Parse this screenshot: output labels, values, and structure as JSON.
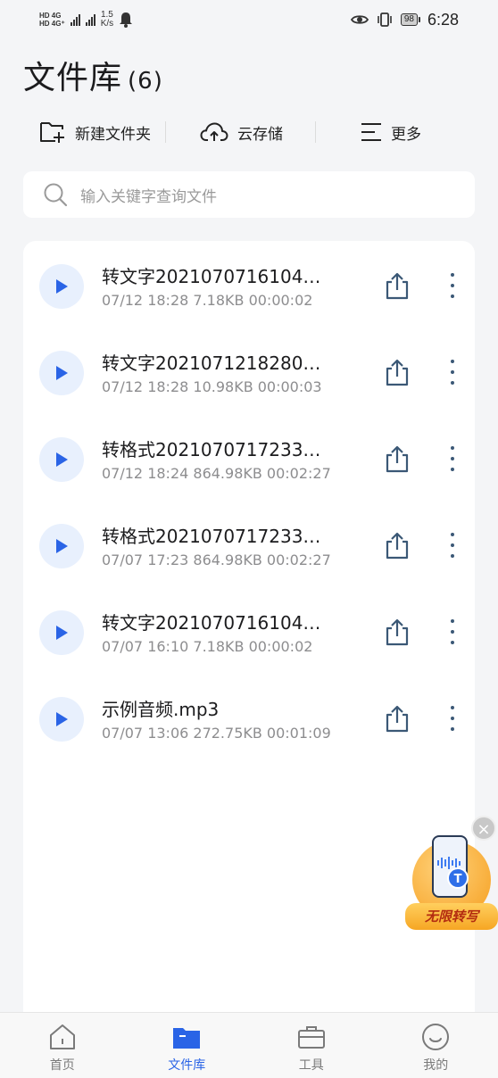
{
  "status_bar": {
    "net1": "4G",
    "net2": "4G⁺",
    "hd1": "HD",
    "hd2": "HD",
    "speed_value": "1.5",
    "speed_unit": "K/s",
    "battery": "98",
    "time": "6:28"
  },
  "header": {
    "title": "文件库",
    "count": "(6)"
  },
  "toolbar": {
    "new_folder_label": "新建文件夹",
    "cloud_label": "云存储",
    "more_label": "更多"
  },
  "search": {
    "placeholder": "输入关键字查询文件"
  },
  "files": [
    {
      "name": "转文字2021070716104…",
      "meta": "07/12 18:28  7.18KB  00:00:02"
    },
    {
      "name": "转文字2021071218280…",
      "meta": "07/12 18:28  10.98KB  00:00:03"
    },
    {
      "name": "转格式2021070717233…",
      "meta": "07/12 18:24  864.98KB  00:02:27"
    },
    {
      "name": "转格式2021070717233…",
      "meta": "07/07 17:23  864.98KB  00:02:27"
    },
    {
      "name": "转文字2021070716104…",
      "meta": "07/07 16:10  7.18KB  00:00:02"
    },
    {
      "name": "示例音频.mp3",
      "meta": "07/07 13:06  272.75KB  00:01:09"
    }
  ],
  "promo": {
    "label": "无限转写",
    "badge": "T"
  },
  "tabs": [
    {
      "label": "首页",
      "icon": "home-icon",
      "active": false
    },
    {
      "label": "文件库",
      "icon": "folder-icon",
      "active": true
    },
    {
      "label": "工具",
      "icon": "toolbox-icon",
      "active": false
    },
    {
      "label": "我的",
      "icon": "profile-icon",
      "active": false
    }
  ],
  "colors": {
    "accent": "#2a64e6",
    "play_bg": "#e8f0fd",
    "icon_dark": "#3b5876",
    "meta_text": "#8d8d8f"
  }
}
